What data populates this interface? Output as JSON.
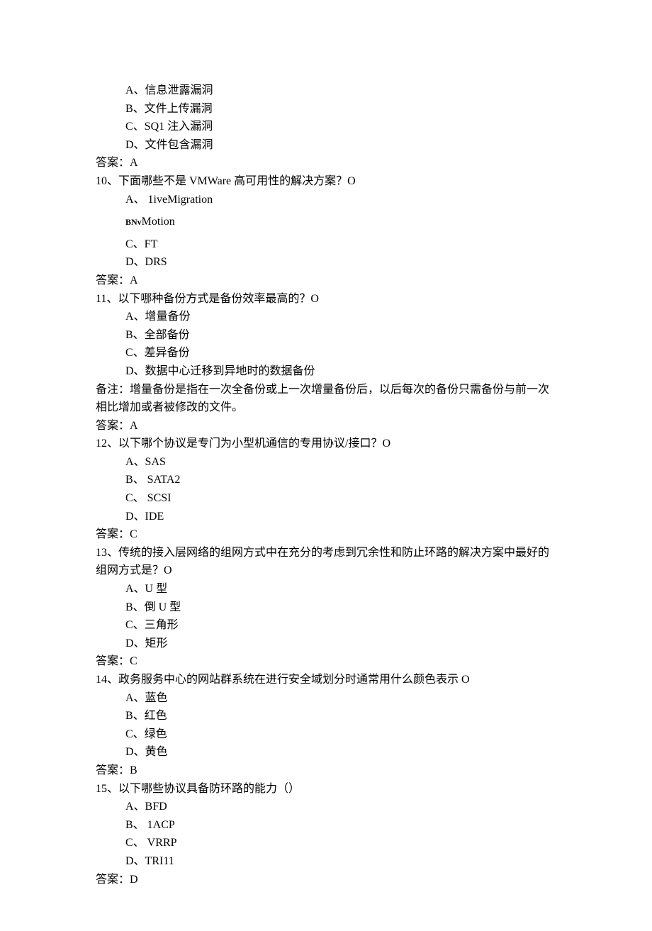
{
  "q9": {
    "opts": [
      "A、信息泄露漏洞",
      "B、文件上传漏洞",
      "C、SQ1 注入漏洞",
      "D、文件包含漏洞"
    ],
    "answer": "答案：A"
  },
  "q10": {
    "text": "10、下面哪些不是 VMWare 高可用性的解决方案？O",
    "optA": "A、 1iveMigration",
    "optB_prefix": "BNv",
    "optB_text": "Motion",
    "optC": "C、FT",
    "optD": "D、DRS",
    "answer": "答案：A"
  },
  "q11": {
    "text": "11、以下哪种备份方式是备份效率最高的？O",
    "opts": [
      "A、增量备份",
      "B、全部备份",
      "C、差异备份",
      "D、数据中心迁移到异地时的数据备份"
    ],
    "note": "备注：增量备份是指在一次全备份或上一次增量备份后，以后每次的备份只需备份与前一次相比增加或者被修改的文件。",
    "answer": "答案：A"
  },
  "q12": {
    "text": "12、以下哪个协议是专门为小型机通信的专用协议/接口？O",
    "opts": [
      "A、SAS",
      "B、 SATA2",
      "C、 SCSI",
      "D、IDE"
    ],
    "answer": "答案：C"
  },
  "q13": {
    "text": "13、传统的接入层网络的组网方式中在充分的考虑到冗余性和防止环路的解决方案中最好的组网方式是？O",
    "opts": [
      "A、U 型",
      "B、倒 U 型",
      "C、三角形",
      "D、矩形"
    ],
    "answer": "答案：C"
  },
  "q14": {
    "text": "14、政务服务中心的网站群系统在进行安全域划分时通常用什么颜色表示 O",
    "opts": [
      "A、蓝色",
      "B、红色",
      "C、绿色",
      "D、黄色"
    ],
    "answer": "答案：B"
  },
  "q15": {
    "text": "15、以下哪些协议具备防环路的能力（）",
    "opts": [
      "A、BFD",
      "B、 1ACP",
      "C、 VRRP",
      "D、TRI11"
    ],
    "answer": "答案：D"
  }
}
